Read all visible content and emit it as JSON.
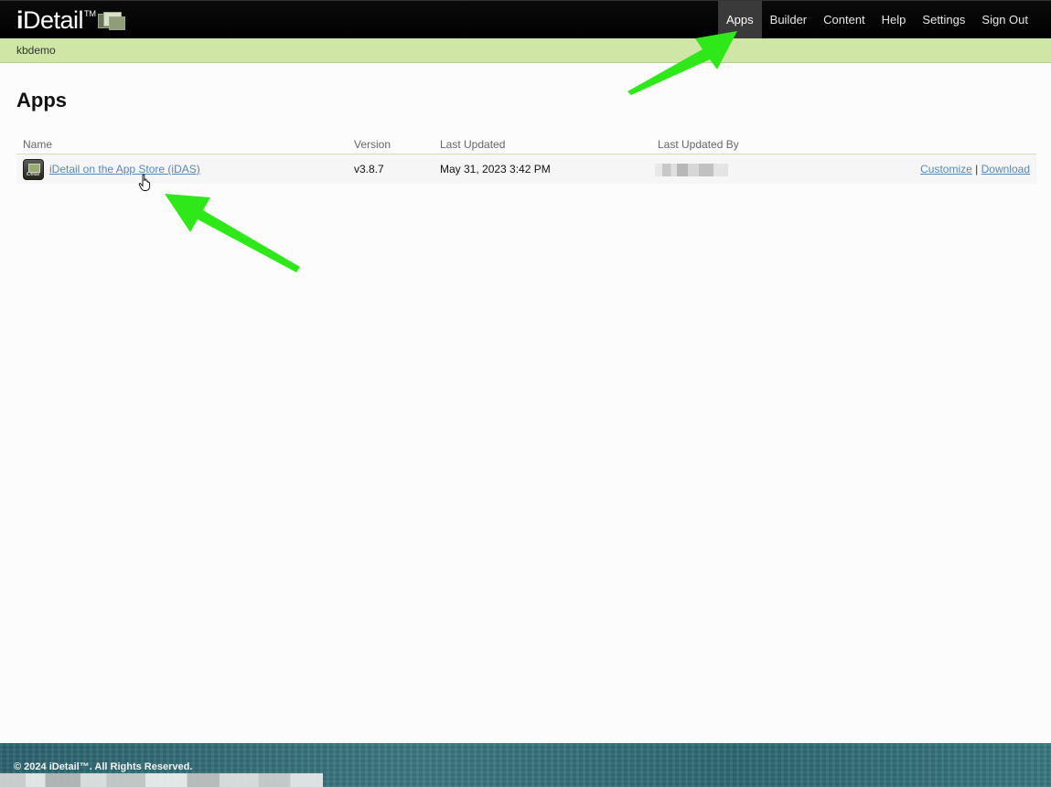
{
  "header": {
    "logo_text": "iDetail",
    "logo_tm": "TM",
    "nav": [
      {
        "label": "Apps"
      },
      {
        "label": "Builder"
      },
      {
        "label": "Content"
      },
      {
        "label": "Help"
      },
      {
        "label": "Settings"
      },
      {
        "label": "Sign Out"
      }
    ],
    "active_nav": "Apps"
  },
  "subbar": {
    "account_name": "kbdemo"
  },
  "main": {
    "title": "Apps",
    "table": {
      "columns": [
        "Name",
        "Version",
        "Last Updated",
        "Last Updated By"
      ],
      "rows": [
        {
          "icon": "app-icon",
          "name": "iDetail on the App Store (iDAS)",
          "version": "v3.8.7",
          "last_updated": "May 31, 2023 3:42 PM",
          "last_updated_by": "",
          "actions": {
            "customize": "Customize",
            "separator": "|",
            "download": "Download"
          }
        }
      ]
    }
  },
  "footer": {
    "copyright": "© 2024 iDetail™.  All Rights Reserved."
  },
  "colors": {
    "header_bg": "#000000",
    "subbar_bg": "#cfe6a7",
    "link": "#5a86b7",
    "footer_bg": "#3a757f",
    "annotation_arrow": "#2ee81a"
  }
}
